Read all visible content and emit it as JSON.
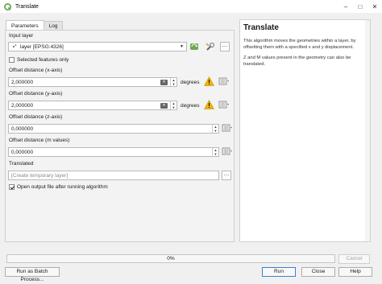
{
  "window": {
    "title": "Translate"
  },
  "tabs": [
    {
      "label": "Parameters"
    },
    {
      "label": "Log"
    }
  ],
  "parameters": {
    "input_layer": {
      "label": "Input layer",
      "value": "layer [EPSG:4326]"
    },
    "selected_only": {
      "label": "Selected features only",
      "checked": false
    },
    "dx": {
      "label": "Offset distance (x-axis)",
      "value": "2,000000",
      "unit": "degrees"
    },
    "dy": {
      "label": "Offset distance (y-axis)",
      "value": "2,000000",
      "unit": "degrees"
    },
    "dz": {
      "label": "Offset distance (z-axis)",
      "value": "0,000000"
    },
    "dm": {
      "label": "Offset distance (m values)",
      "value": "0,000000"
    },
    "output": {
      "label": "Translated",
      "placeholder": "[Create temporary layer]"
    },
    "open_output": {
      "label": "Open output file after running algorithm",
      "checked": true
    }
  },
  "help": {
    "title": "Translate",
    "text1": "This algorithm moves the geometries within a layer, by offsetting them with a specified x and y displacement.",
    "text2": "Z and M values present in the geometry can also be translated."
  },
  "progress": {
    "label": "0%",
    "value": 0
  },
  "buttons": {
    "cancel": "Cancel",
    "batch": "Run as Batch Process...",
    "run": "Run",
    "close": "Close",
    "help": "Help"
  },
  "colors": {
    "qgis_green": "#6aa84f",
    "warning": "#f0b400",
    "link_blue": "#3c7fd1"
  }
}
